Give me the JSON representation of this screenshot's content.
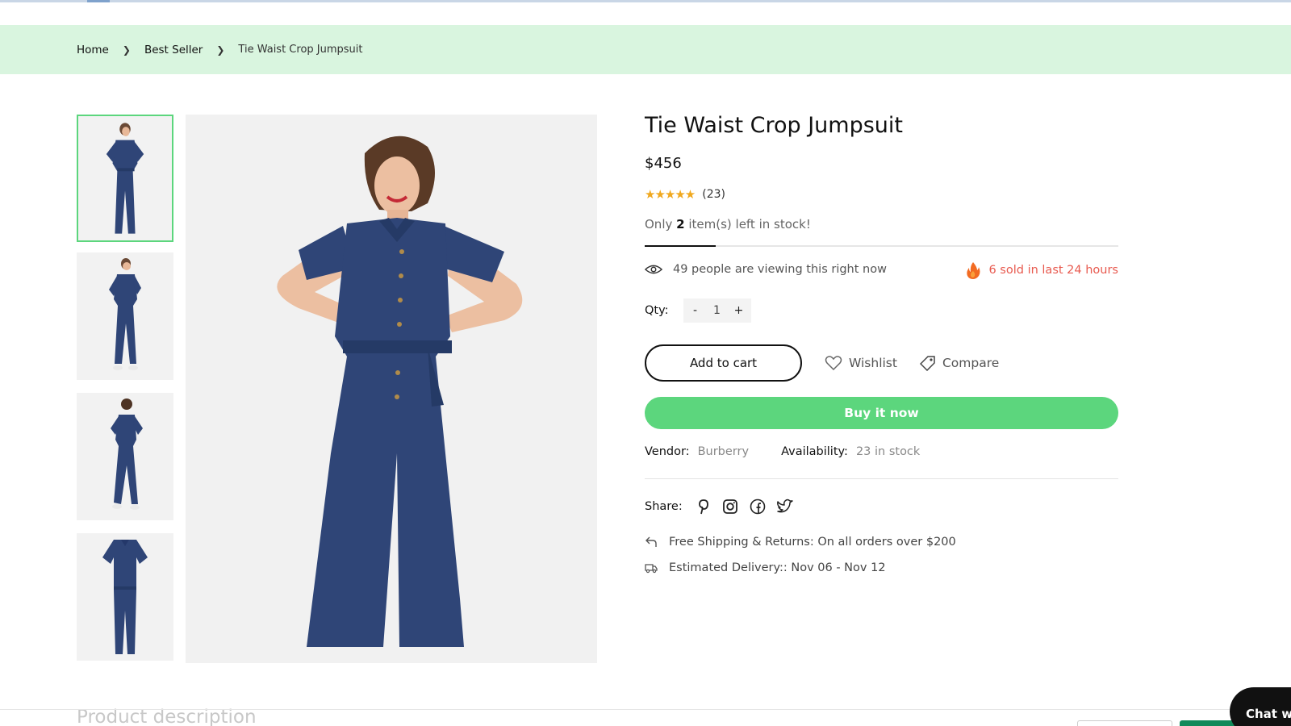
{
  "breadcrumb": {
    "home": "Home",
    "category": "Best Seller",
    "current": "Tie Waist Crop Jumpsuit"
  },
  "gallery": {
    "thumbnails": [
      "front view",
      "front view full",
      "back view",
      "flat lay"
    ],
    "active_index": 0
  },
  "product": {
    "title": "Tie Waist Crop Jumpsuit",
    "price": "$456",
    "rating_stars": "★★★★★",
    "rating_value": 5,
    "review_count": "(23)",
    "stock_prefix": "Only ",
    "stock_count": "2",
    "stock_suffix": " item(s) left in stock!",
    "stock_level_fraction": 0.15,
    "viewing_text": "49 people are viewing this right now",
    "sold_text": "6 sold in last 24 hours",
    "qty_label": "Qty:",
    "qty_minus": "-",
    "qty_value": "1",
    "qty_plus": "+",
    "add_to_cart": "Add to cart",
    "wishlist": "Wishlist",
    "compare": "Compare",
    "buy_now": "Buy it now",
    "vendor_label": "Vendor:",
    "vendor_value": "Burberry",
    "availability_label": "Availability:",
    "availability_value": "23 in stock",
    "share_label": "Share:",
    "share_icons": [
      "pinterest-icon",
      "instagram-icon",
      "facebook-icon",
      "twitter-icon"
    ],
    "shipping_text": "Free Shipping & Returns: On all orders over $200",
    "delivery_text": "Estimated Delivery:: Nov 06 - Nov 12"
  },
  "footer": {
    "description_heading": "Product description",
    "chat_label": "Chat wit"
  },
  "colors": {
    "accent_green": "#5cd67d",
    "breadcrumb_bg": "#d9f5df",
    "sold_red": "#e85a4f",
    "star_orange": "#f0a81e"
  }
}
